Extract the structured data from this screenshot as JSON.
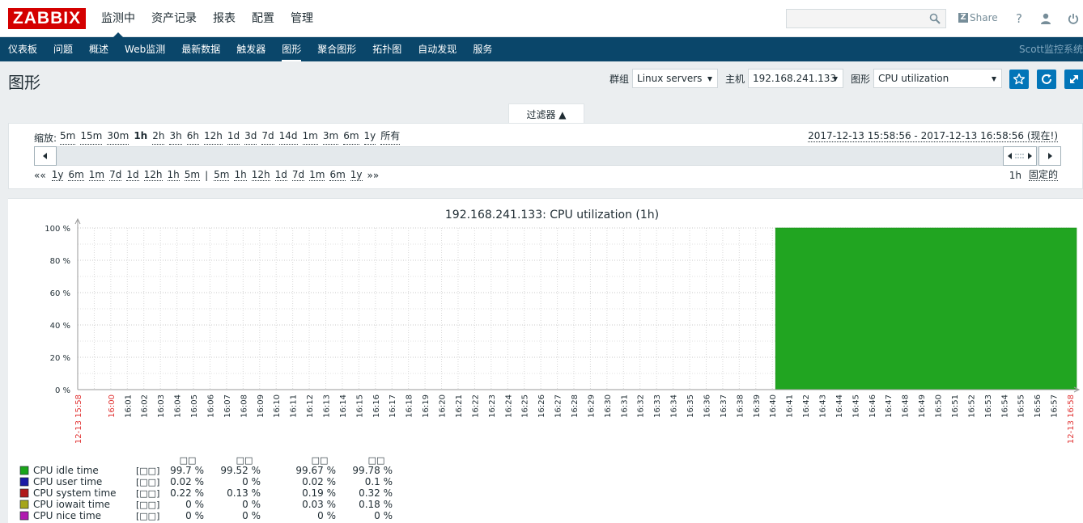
{
  "header": {
    "logo": "ZABBIX",
    "top_nav": [
      {
        "label": "监测中",
        "active": true
      },
      {
        "label": "资产记录",
        "active": false
      },
      {
        "label": "报表",
        "active": false
      },
      {
        "label": "配置",
        "active": false
      },
      {
        "label": "管理",
        "active": false
      }
    ],
    "search_placeholder": "",
    "share_label": "Share",
    "help_icon": "?",
    "icons": [
      "search-icon",
      "share-icon",
      "help-icon",
      "user-icon",
      "power-icon"
    ]
  },
  "sub_nav": {
    "items": [
      {
        "label": "仪表板",
        "active": false
      },
      {
        "label": "问题",
        "active": false
      },
      {
        "label": "概述",
        "active": false
      },
      {
        "label": "Web监测",
        "active": false
      },
      {
        "label": "最新数据",
        "active": false
      },
      {
        "label": "触发器",
        "active": false
      },
      {
        "label": "图形",
        "active": true
      },
      {
        "label": "聚合图形",
        "active": false
      },
      {
        "label": "拓扑图",
        "active": false
      },
      {
        "label": "自动发现",
        "active": false
      },
      {
        "label": "服务",
        "active": false
      }
    ],
    "right_text": "Scott监控系统"
  },
  "page": {
    "title": "图形",
    "group_label": "群组",
    "group_value": "Linux servers",
    "host_label": "主机",
    "host_value": "192.168.241.133",
    "graph_label": "图形",
    "graph_value": "CPU utilization"
  },
  "filter": {
    "tab_label": "过滤器 ▲",
    "zoom_label": "缩放:",
    "zoom_options": [
      "5m",
      "15m",
      "30m",
      "1h",
      "2h",
      "3h",
      "6h",
      "12h",
      "1d",
      "3d",
      "7d",
      "14d",
      "1m",
      "3m",
      "6m",
      "1y",
      "所有"
    ],
    "zoom_current": "1h",
    "period_text": "2017-12-13 15:58:56 - 2017-12-13 16:58:56 (现在!)",
    "back_links": [
      "1y",
      "6m",
      "1m",
      "7d",
      "1d",
      "12h",
      "1h",
      "5m"
    ],
    "fwd_links": [
      "5m",
      "1h",
      "12h",
      "1d",
      "7d",
      "1m",
      "6m",
      "1y"
    ],
    "back_arrows": "««",
    "separator": "|",
    "fwd_arrows": "»»",
    "period_value": "1h",
    "fixed_label": "固定的"
  },
  "chart_data": {
    "type": "area",
    "title": "192.168.241.133: CPU utilization (1h)",
    "y_unit": "%",
    "ylim": [
      0,
      100
    ],
    "y_ticks": [
      "0 %",
      "20 %",
      "40 %",
      "60 %",
      "80 %",
      "100 %"
    ],
    "x_start_label": "12-13 15:58",
    "x_end_label": "12-13 16:58",
    "x_minutes": [
      "16:00",
      "16:01",
      "16:02",
      "16:03",
      "16:04",
      "16:05",
      "16:06",
      "16:07",
      "16:08",
      "16:09",
      "16:10",
      "16:11",
      "16:12",
      "16:13",
      "16:14",
      "16:15",
      "16:16",
      "16:17",
      "16:18",
      "16:19",
      "16:20",
      "16:21",
      "16:22",
      "16:23",
      "16:24",
      "16:25",
      "16:26",
      "16:27",
      "16:28",
      "16:29",
      "16:30",
      "16:31",
      "16:32",
      "16:33",
      "16:34",
      "16:35",
      "16:36",
      "16:37",
      "16:38",
      "16:39",
      "16:40",
      "16:41",
      "16:42",
      "16:43",
      "16:44",
      "16:45",
      "16:46",
      "16:47",
      "16:48",
      "16:49",
      "16:50",
      "16:51",
      "16:52",
      "16:53",
      "16:54",
      "16:55",
      "16:56",
      "16:57",
      "16:58"
    ],
    "red_labels": [
      "12-13 15:58",
      "16:00",
      "12-13 16:58"
    ],
    "data_start": "16:40",
    "data_end": "16:58",
    "stacked_total": 100,
    "fill_color": "#21a521",
    "legend_headers": [
      "□□",
      "□□",
      "□□",
      "□□"
    ],
    "legend_bracket": "[□□]",
    "series": [
      {
        "name": "CPU idle time",
        "color": "#1aa51a",
        "last": "99.7 %",
        "min": "99.52 %",
        "avg": "99.67 %",
        "max": "99.78 %"
      },
      {
        "name": "CPU user time",
        "color": "#1a1aa5",
        "last": "0.02 %",
        "min": "0 %",
        "avg": "0.02 %",
        "max": "0.1 %"
      },
      {
        "name": "CPU system time",
        "color": "#b01a1a",
        "last": "0.22 %",
        "min": "0.13 %",
        "avg": "0.19 %",
        "max": "0.32 %"
      },
      {
        "name": "CPU iowait time",
        "color": "#a5a51a",
        "last": "0 %",
        "min": "0 %",
        "avg": "0.03 %",
        "max": "0.18 %"
      },
      {
        "name": "CPU nice time",
        "color": "#b01ab0",
        "last": "0 %",
        "min": "0 %",
        "avg": "0 %",
        "max": "0 %"
      }
    ]
  }
}
